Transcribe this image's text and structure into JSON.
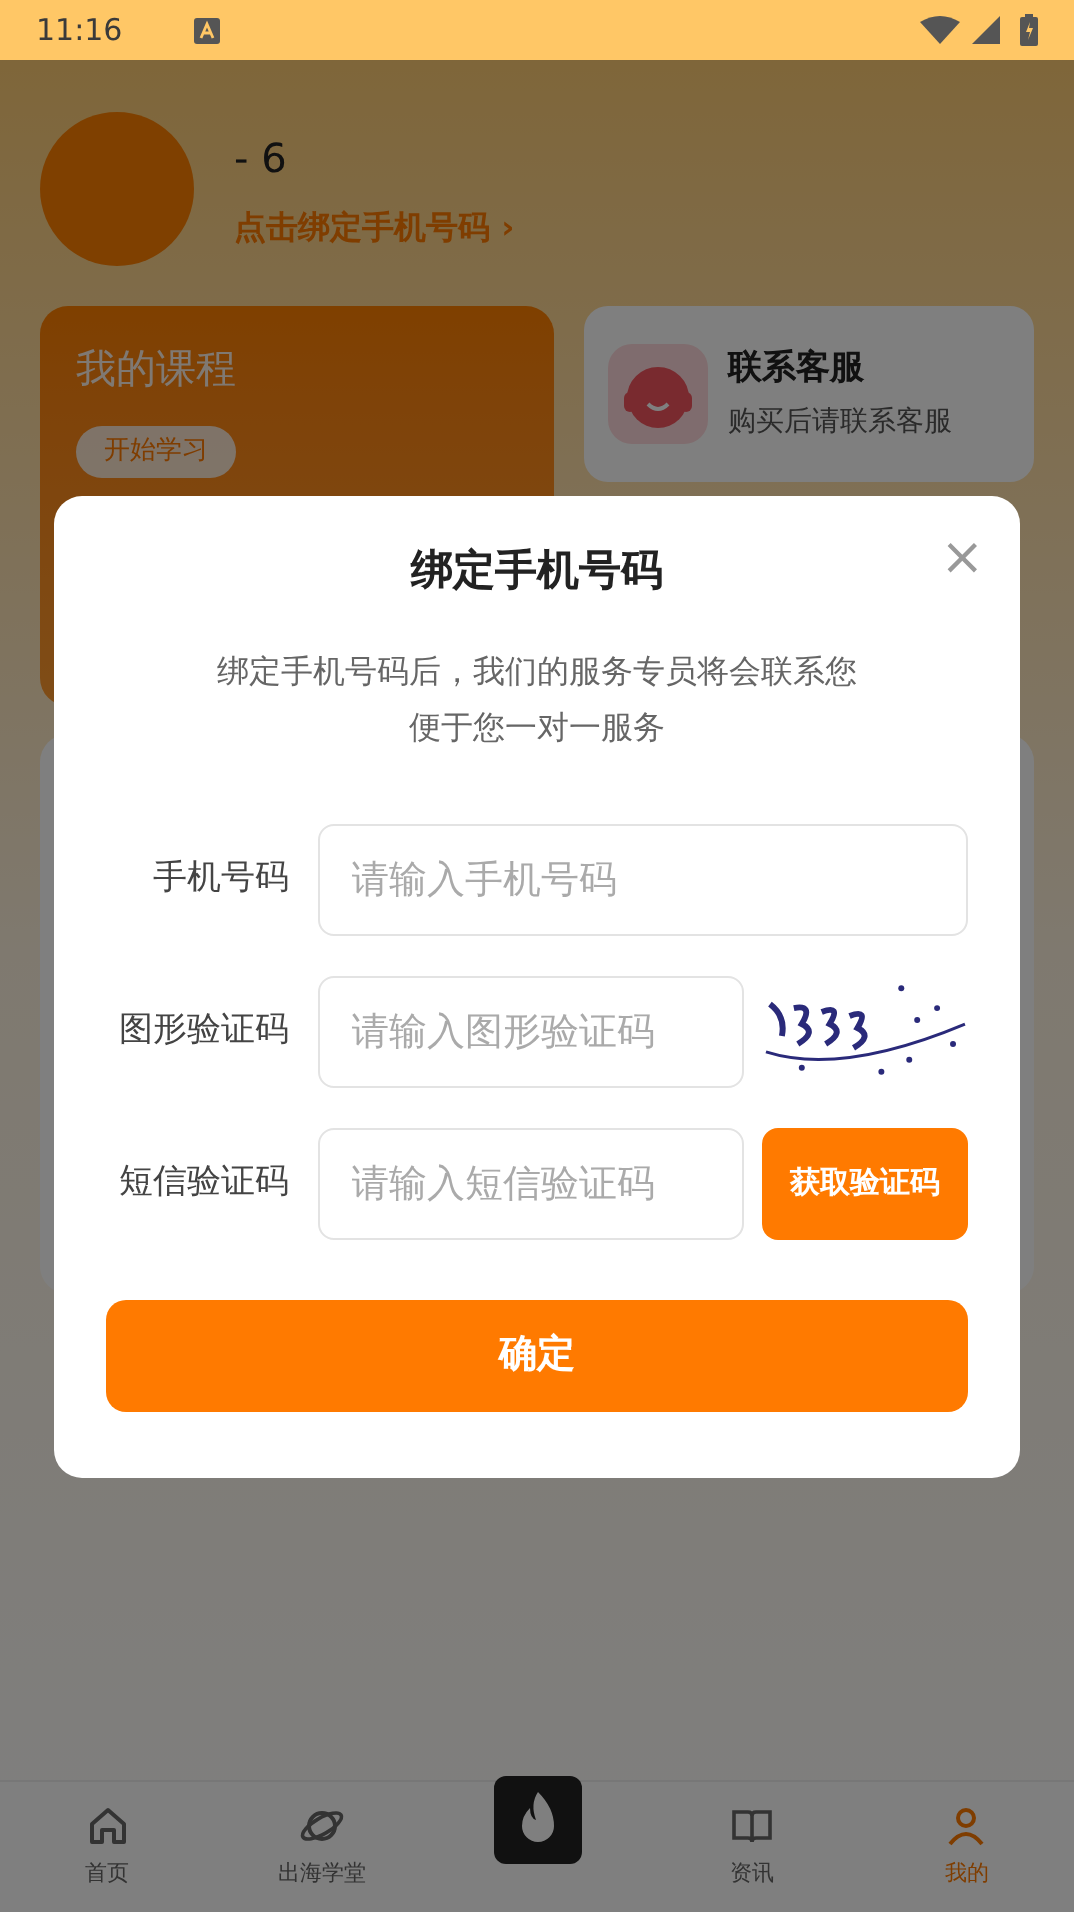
{
  "status_bar": {
    "time": "11:16"
  },
  "profile": {
    "name": "- 6",
    "bind_link": "点击绑定手机号码 ›"
  },
  "cards": [
    {
      "kind": "course",
      "title": "我的课程",
      "button": "开始学习"
    },
    {
      "kind": "service",
      "title": "联系客服",
      "subtitle": "购买后请联系客服"
    }
  ],
  "nav": [
    {
      "label": "首页",
      "kind": "home",
      "selected": false
    },
    {
      "label": "出海学堂",
      "kind": "planet",
      "selected": false
    },
    {
      "label": "资讯",
      "kind": "book",
      "selected": false
    },
    {
      "label": "我的",
      "kind": "person",
      "selected": true
    }
  ],
  "dialog": {
    "title": "绑定手机号码",
    "close": "×",
    "description": [
      "绑定手机号码后，我们的服务专员将会联系您",
      "便于您一对一服务"
    ],
    "fields": [
      {
        "kind": "text",
        "label": "手机号码",
        "placeholder": "请输入手机号码"
      },
      {
        "kind": "captcha",
        "label": "图形验证码",
        "placeholder": "请输入图形验证码"
      },
      {
        "kind": "sms",
        "label": "短信验证码",
        "placeholder": "请输入短信验证码",
        "button": "获取验证码"
      }
    ],
    "confirm": "确定"
  }
}
